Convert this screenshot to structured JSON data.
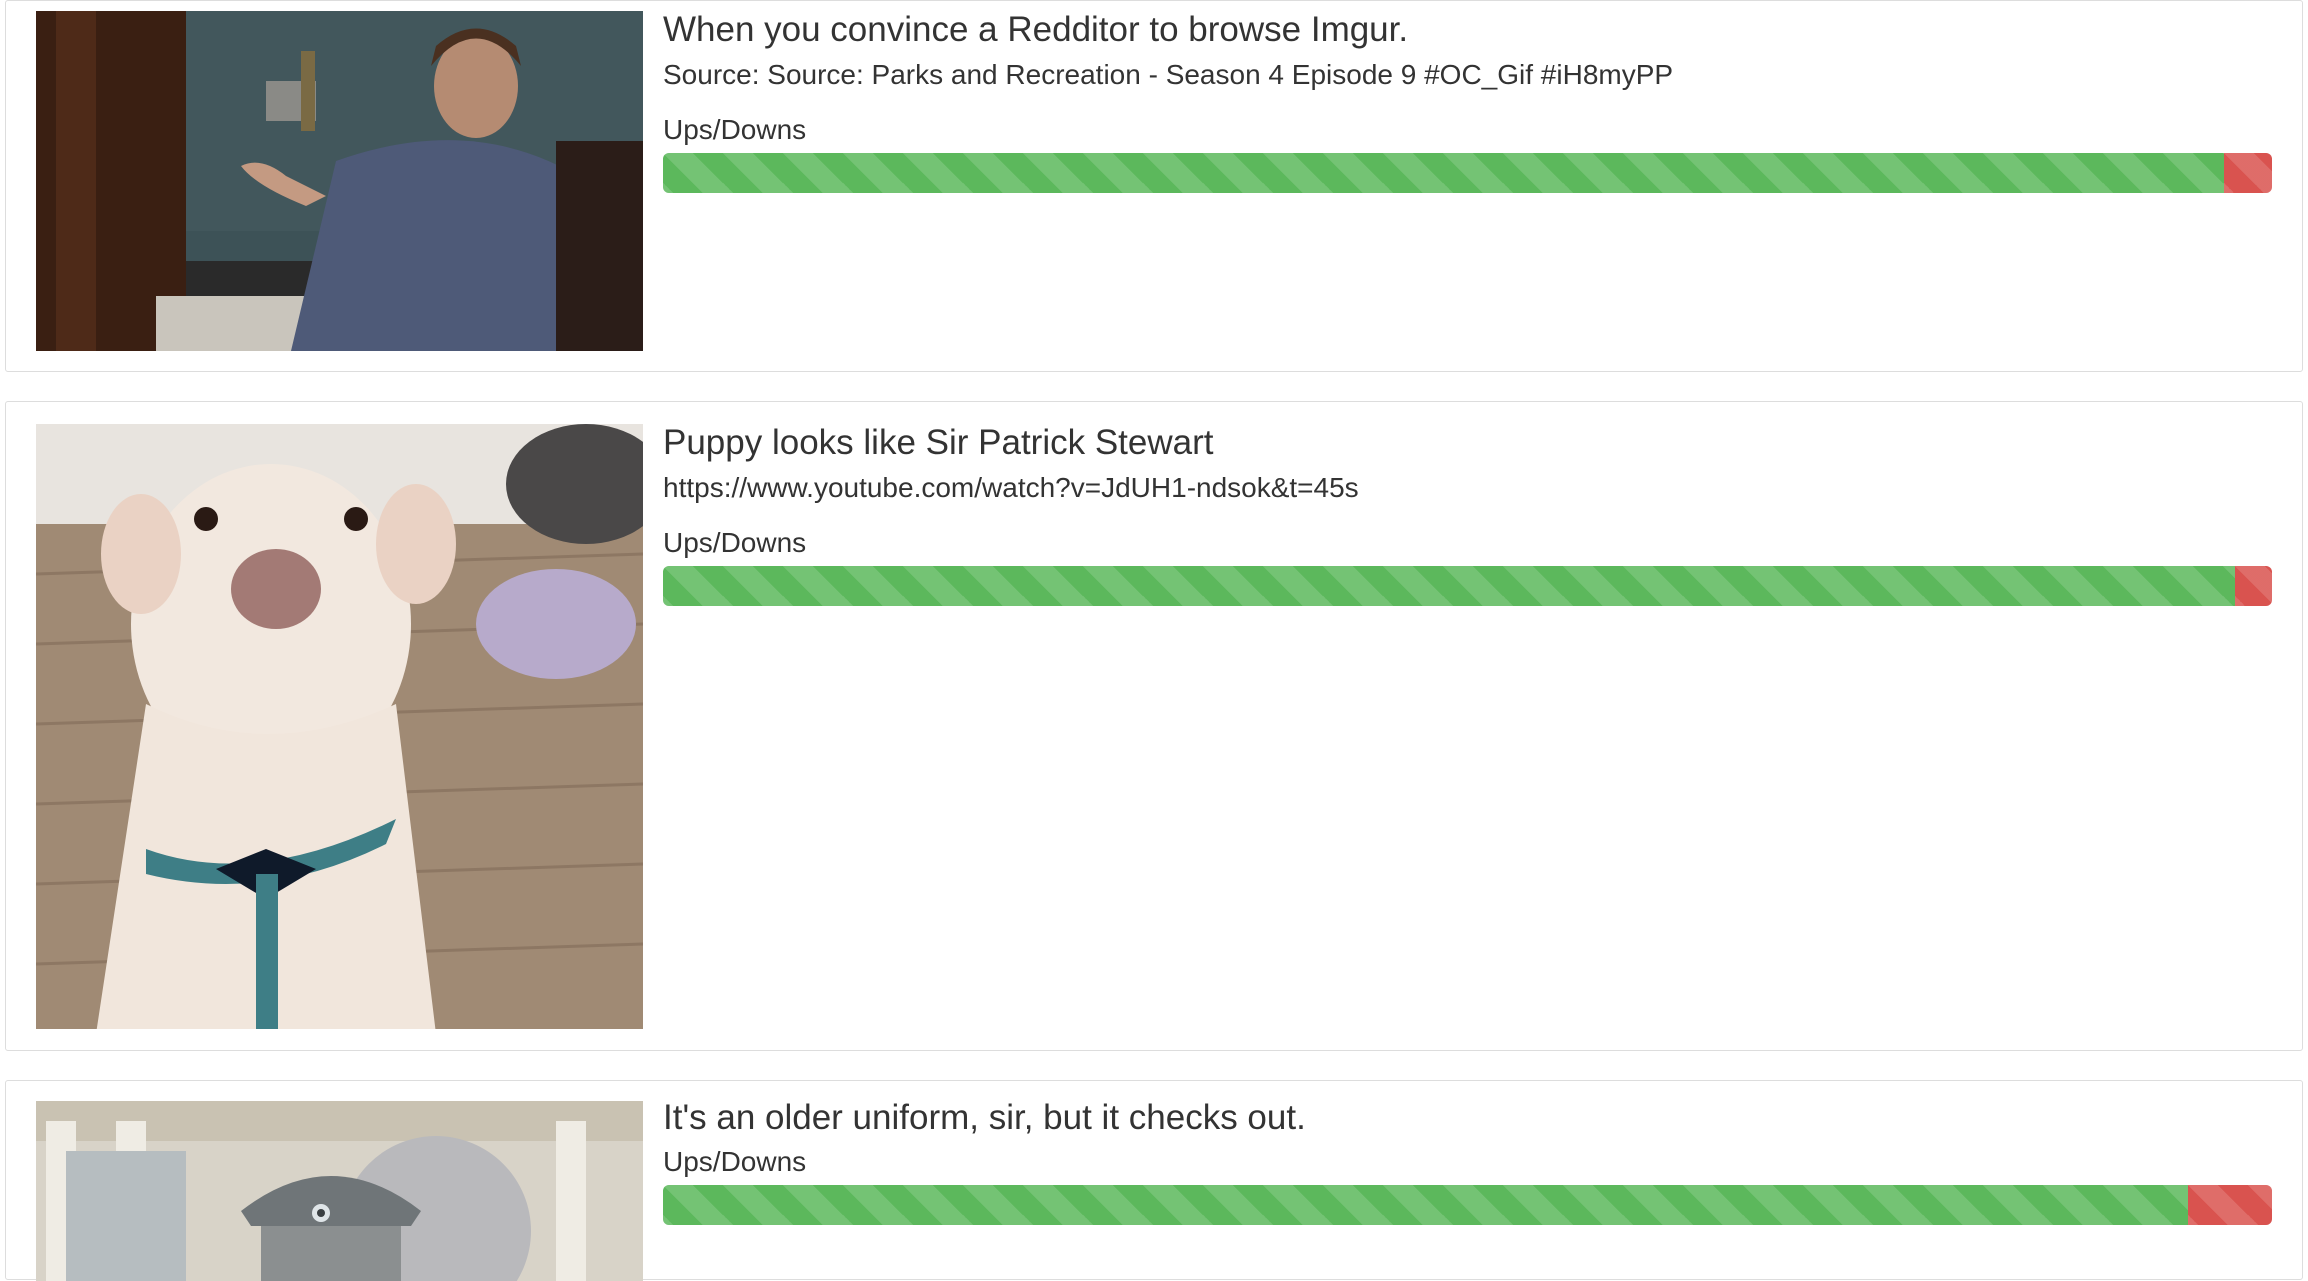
{
  "colors": {
    "up": "#5cb85c",
    "down": "#d9534f",
    "border": "#dddddd",
    "text": "#333333"
  },
  "posts": [
    {
      "title": "When you convince a Redditor to browse Imgur.",
      "source": "Source: Source: Parks and Recreation - Season 4 Episode 9 #OC_Gif #iH8myPP",
      "votes_label": "Ups/Downs",
      "up_fraction": 0.97,
      "down_fraction": 0.03
    },
    {
      "title": "Puppy looks like Sir Patrick Stewart",
      "source": "https://www.youtube.com/watch?v=JdUH1-ndsok&t=45s",
      "votes_label": "Ups/Downs",
      "up_fraction": 0.977,
      "down_fraction": 0.023
    },
    {
      "title": "It's an older uniform, sir, but it checks out.",
      "source": "",
      "votes_label": "Ups/Downs",
      "up_fraction": 0.948,
      "down_fraction": 0.052
    }
  ]
}
